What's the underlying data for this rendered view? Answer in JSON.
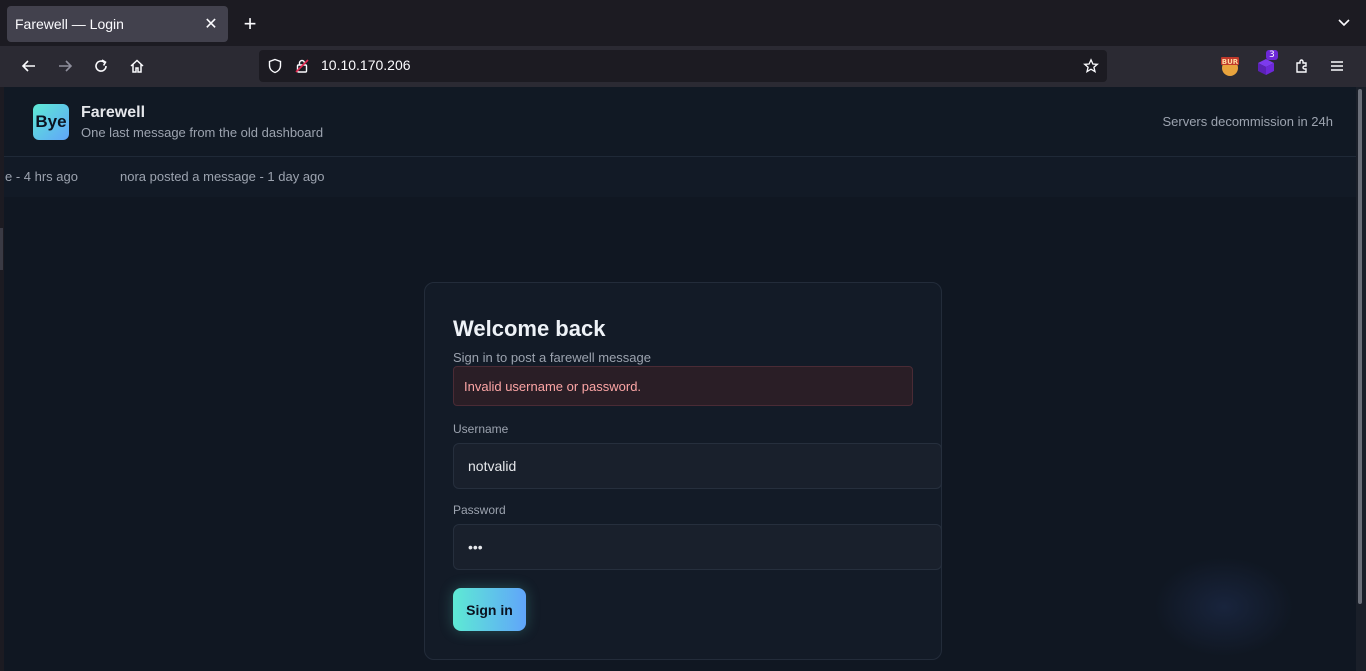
{
  "browser": {
    "tab_title": "Farewell — Login",
    "tab_close": "✕",
    "new_tab": "+",
    "url": "10.10.170.206",
    "extension_badge_count": "3"
  },
  "header": {
    "logo_text": "Bye",
    "title": "Farewell",
    "subtitle": "One last message from the old dashboard",
    "notice": "Servers decommission in 24h"
  },
  "ticker": {
    "items": [
      "e - 4 hrs ago",
      "nora posted a message - 1 day ago"
    ]
  },
  "login": {
    "title": "Welcome back",
    "subtitle": "Sign in to post a farewell message",
    "error": "Invalid username or password.",
    "username_label": "Username",
    "username_value": "notvalid",
    "password_label": "Password",
    "password_value": "•••",
    "submit_label": "Sign in"
  },
  "colors": {
    "accent_start": "#5eead4",
    "accent_end": "#60a5fa",
    "error_text": "#fca5a5",
    "page_bg": "#101722"
  }
}
